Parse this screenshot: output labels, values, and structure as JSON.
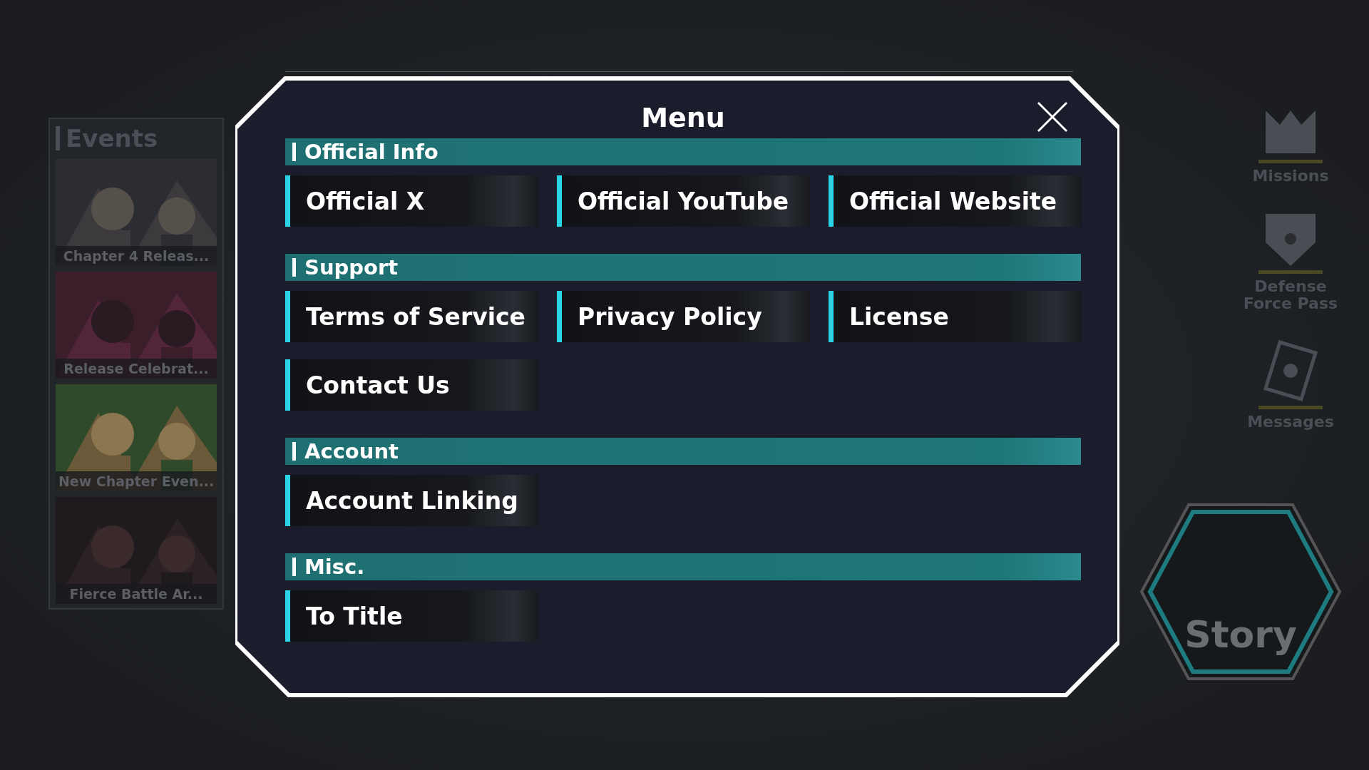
{
  "background": {
    "events": {
      "title": "Events",
      "cards": [
        {
          "caption": "Chapter 4 Releas...",
          "kind": "picture"
        },
        {
          "caption": "Release Celebrat...",
          "kind": "picture"
        },
        {
          "caption": "New Chapter Even...",
          "kind": "picture"
        },
        {
          "caption": "Fierce Battle Ar...",
          "kind": "picture"
        }
      ]
    },
    "side_menu": [
      {
        "label": "Missions",
        "kind": "missions"
      },
      {
        "label": "Defense Force Pass",
        "kind": "pass"
      },
      {
        "label": "Messages",
        "kind": "messages"
      }
    ],
    "story_button": {
      "label": "Story"
    }
  },
  "dialog": {
    "title": "Menu",
    "sections": [
      {
        "title": "Official Info",
        "buttons": [
          "Official X",
          "Official YouTube",
          "Official Website"
        ]
      },
      {
        "title": "Support",
        "buttons": [
          "Terms of Service",
          "Privacy Policy",
          "License",
          "Contact Us"
        ]
      },
      {
        "title": "Account",
        "buttons": [
          "Account Linking"
        ]
      },
      {
        "title": "Misc.",
        "buttons": [
          "To Title"
        ]
      }
    ]
  }
}
